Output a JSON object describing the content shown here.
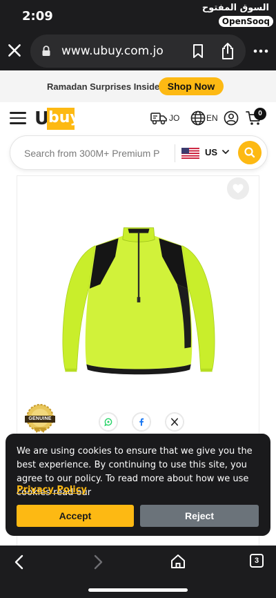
{
  "status_bar": {
    "time": "2:09",
    "watermark_ar": "السوق المفتوح",
    "watermark_en": "OpenSooq"
  },
  "browser": {
    "url": "www.ubuy.com.jo",
    "open_tabs": "3"
  },
  "promo": {
    "text": "Ramadan Surprises Inside",
    "button": "Shop Now"
  },
  "header": {
    "logo_u": "U",
    "logo_buy": "buy",
    "country": "JO",
    "language": "EN",
    "cart_count": "0"
  },
  "search": {
    "placeholder": "Search from 300M+ Premium P",
    "region": "US"
  },
  "product": {
    "badge_text": "GENUINE",
    "share_targets": [
      "whatsapp",
      "facebook",
      "x"
    ]
  },
  "cookie": {
    "message": "We are using cookies to ensure that we give you the best experience. By continuing to use this site, you agree to our policy. To read more about how we use cookies read our",
    "link": "Privacy Policy",
    "accept": "Accept",
    "reject": "Reject"
  },
  "colors": {
    "accent": "#fdb913",
    "dark_bg": "#1c1c1e",
    "reject_bg": "#6b737a"
  }
}
